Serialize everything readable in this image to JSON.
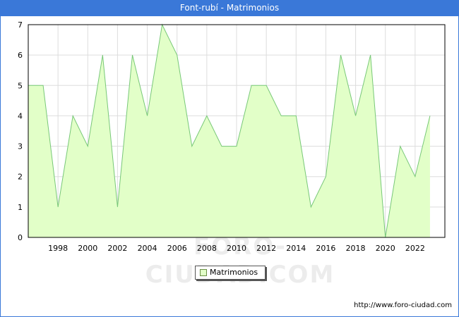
{
  "header": {
    "title": "Font-rubí - Matrimonios"
  },
  "footer": {
    "url": "http://www.foro-ciudad.com"
  },
  "watermark": "FORO-CIUDAD.COM",
  "colors": {
    "title_bar": "#3a78d8",
    "area_fill": "#e2ffc8",
    "area_line": "#78c878",
    "grid": "#dddddd"
  },
  "chart_data": {
    "type": "area",
    "title": "Font-rubí - Matrimonios",
    "xlabel": "",
    "ylabel": "",
    "x": [
      1996,
      1997,
      1998,
      1999,
      2000,
      2001,
      2002,
      2003,
      2004,
      2005,
      2006,
      2007,
      2008,
      2009,
      2010,
      2011,
      2012,
      2013,
      2014,
      2015,
      2016,
      2017,
      2018,
      2019,
      2020,
      2021,
      2022,
      2023
    ],
    "series": [
      {
        "name": "Matrimonios",
        "values": [
          5,
          5,
          1,
          4,
          3,
          6,
          1,
          6,
          4,
          7,
          6,
          3,
          4,
          3,
          3,
          5,
          5,
          4,
          4,
          1,
          2,
          6,
          4,
          6,
          0,
          3,
          2,
          4
        ]
      }
    ],
    "xticks": [
      "1998",
      "2000",
      "2002",
      "2004",
      "2006",
      "2008",
      "2010",
      "2012",
      "2014",
      "2016",
      "2018",
      "2020",
      "2022"
    ],
    "yticks": [
      "0",
      "1",
      "2",
      "3",
      "4",
      "5",
      "6",
      "7"
    ],
    "xlim": [
      1996,
      2024
    ],
    "ylim": [
      0,
      7
    ],
    "grid": true,
    "legend": {
      "position": "bottom-center",
      "label": "Matrimonios"
    }
  }
}
